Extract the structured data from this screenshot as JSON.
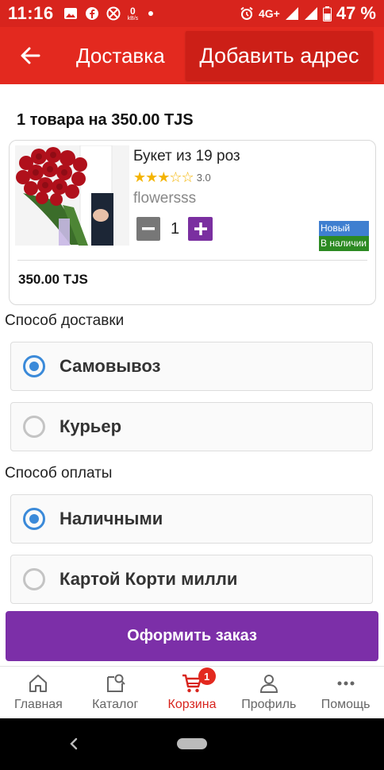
{
  "status_bar": {
    "time": "11:16",
    "speed_value": "0",
    "speed_unit": "kB/s",
    "network": "4G+",
    "battery": "47 %"
  },
  "app_bar": {
    "title": "Доставка",
    "add_address": "Добавить адрес"
  },
  "cart": {
    "summary": "1 товара на 350.00 TJS",
    "item": {
      "name": "Букет из 19 роз",
      "rating": "3.0",
      "rating_stars": 3,
      "seller": "flowersss",
      "quantity": "1",
      "badge_new": "Новый",
      "badge_stock": "В наличии",
      "price": "350.00 TJS"
    }
  },
  "delivery": {
    "label": "Способ доставки",
    "options": [
      {
        "label": "Самовывоз",
        "selected": true
      },
      {
        "label": "Курьер",
        "selected": false
      }
    ]
  },
  "payment": {
    "label": "Способ оплаты",
    "options": [
      {
        "label": "Наличными",
        "selected": true
      },
      {
        "label": "Картой Корти милли",
        "selected": false
      }
    ]
  },
  "order_button": "Оформить заказ",
  "bottom_nav": {
    "items": [
      {
        "label": "Главная",
        "icon": "home-icon"
      },
      {
        "label": "Каталог",
        "icon": "catalog-icon"
      },
      {
        "label": "Корзина",
        "icon": "cart-icon",
        "active": true,
        "badge": "1"
      },
      {
        "label": "Профиль",
        "icon": "profile-icon"
      },
      {
        "label": "Помощь",
        "icon": "more-icon"
      }
    ]
  },
  "colors": {
    "primary_red": "#e3291f",
    "accent_purple": "#7c2fa8",
    "radio_blue": "#3b8ad9",
    "badge_new": "#3f7fd0",
    "badge_stock": "#2c8a22"
  }
}
